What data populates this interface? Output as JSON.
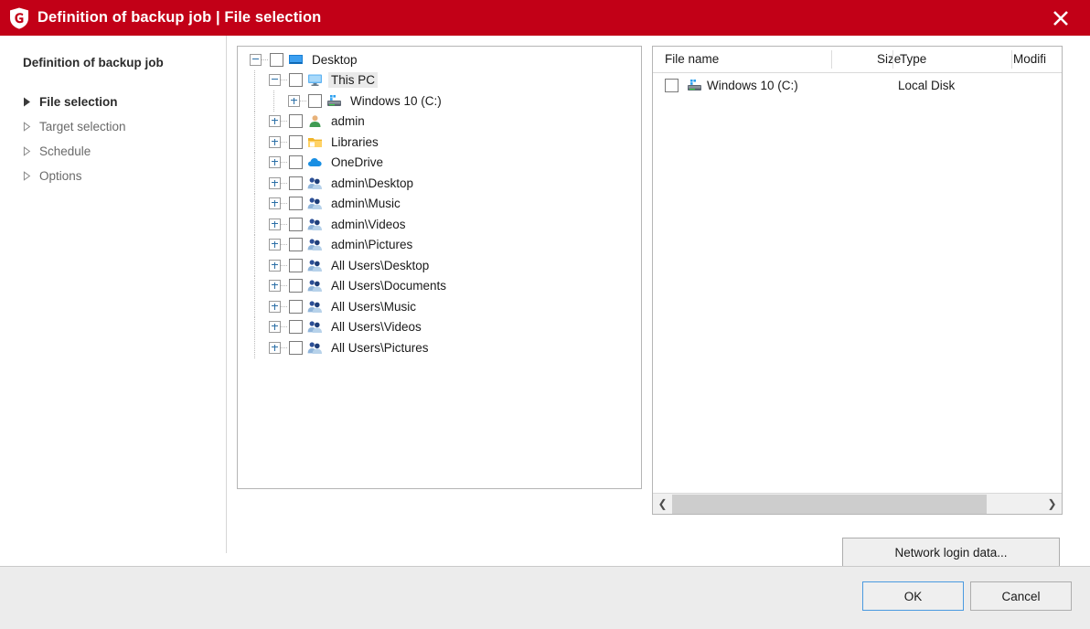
{
  "window": {
    "title": "Definition of backup job | File selection",
    "logo_icon": "shield-g-logo",
    "close_icon": "close-x-icon",
    "accent_color": "#c20017"
  },
  "sidebar": {
    "heading": "Definition of backup job",
    "items": [
      {
        "label": "File selection",
        "active": true,
        "bullet_icon": "triangle-filled-icon"
      },
      {
        "label": "Target selection",
        "active": false,
        "bullet_icon": "triangle-outline-icon"
      },
      {
        "label": "Schedule",
        "active": false,
        "bullet_icon": "triangle-outline-icon"
      },
      {
        "label": "Options",
        "active": false,
        "bullet_icon": "triangle-outline-icon"
      }
    ]
  },
  "tree": {
    "nodes": [
      {
        "label": "Desktop",
        "level": 0,
        "expander": "minus",
        "checked": false,
        "icon": "desktop-icon",
        "selected": false
      },
      {
        "label": "This PC",
        "level": 1,
        "expander": "minus",
        "checked": false,
        "icon": "monitor-icon",
        "selected": true
      },
      {
        "label": "Windows 10 (C:)",
        "level": 2,
        "expander": "plus",
        "checked": false,
        "icon": "harddisk-icon",
        "selected": false
      },
      {
        "label": "admin",
        "level": 1,
        "expander": "plus",
        "checked": false,
        "icon": "user-icon",
        "selected": false
      },
      {
        "label": "Libraries",
        "level": 1,
        "expander": "plus",
        "checked": false,
        "icon": "libraries-icon",
        "selected": false
      },
      {
        "label": "OneDrive",
        "level": 1,
        "expander": "plus",
        "checked": false,
        "icon": "onedrive-icon",
        "selected": false
      },
      {
        "label": "admin\\Desktop",
        "level": 1,
        "expander": "plus",
        "checked": false,
        "icon": "users-icon",
        "selected": false
      },
      {
        "label": "admin\\Music",
        "level": 1,
        "expander": "plus",
        "checked": false,
        "icon": "users-icon",
        "selected": false
      },
      {
        "label": "admin\\Videos",
        "level": 1,
        "expander": "plus",
        "checked": false,
        "icon": "users-icon",
        "selected": false
      },
      {
        "label": "admin\\Pictures",
        "level": 1,
        "expander": "plus",
        "checked": false,
        "icon": "users-icon",
        "selected": false
      },
      {
        "label": "All Users\\Desktop",
        "level": 1,
        "expander": "plus",
        "checked": false,
        "icon": "users-icon",
        "selected": false
      },
      {
        "label": "All Users\\Documents",
        "level": 1,
        "expander": "plus",
        "checked": false,
        "icon": "users-icon",
        "selected": false
      },
      {
        "label": "All Users\\Music",
        "level": 1,
        "expander": "plus",
        "checked": false,
        "icon": "users-icon",
        "selected": false
      },
      {
        "label": "All Users\\Videos",
        "level": 1,
        "expander": "plus",
        "checked": false,
        "icon": "users-icon",
        "selected": false
      },
      {
        "label": "All Users\\Pictures",
        "level": 1,
        "expander": "plus",
        "checked": false,
        "icon": "users-icon",
        "selected": false
      }
    ]
  },
  "file_list": {
    "columns": [
      {
        "label": "File name",
        "align": "left"
      },
      {
        "label": "Size",
        "align": "right"
      },
      {
        "label": "Type",
        "align": "left"
      },
      {
        "label": "Modifi",
        "align": "left"
      }
    ],
    "rows": [
      {
        "name": "Windows 10 (C:)",
        "size": "",
        "type": "Local Disk",
        "modified": "",
        "checked": false,
        "icon": "harddisk-icon"
      }
    ],
    "scrollbar": {
      "left_arrow_icon": "chevron-left-icon",
      "right_arrow_icon": "chevron-right-icon",
      "thumb_percent": 85
    }
  },
  "buttons": {
    "network_login": "Network login data...",
    "ok": "OK",
    "cancel": "Cancel"
  }
}
